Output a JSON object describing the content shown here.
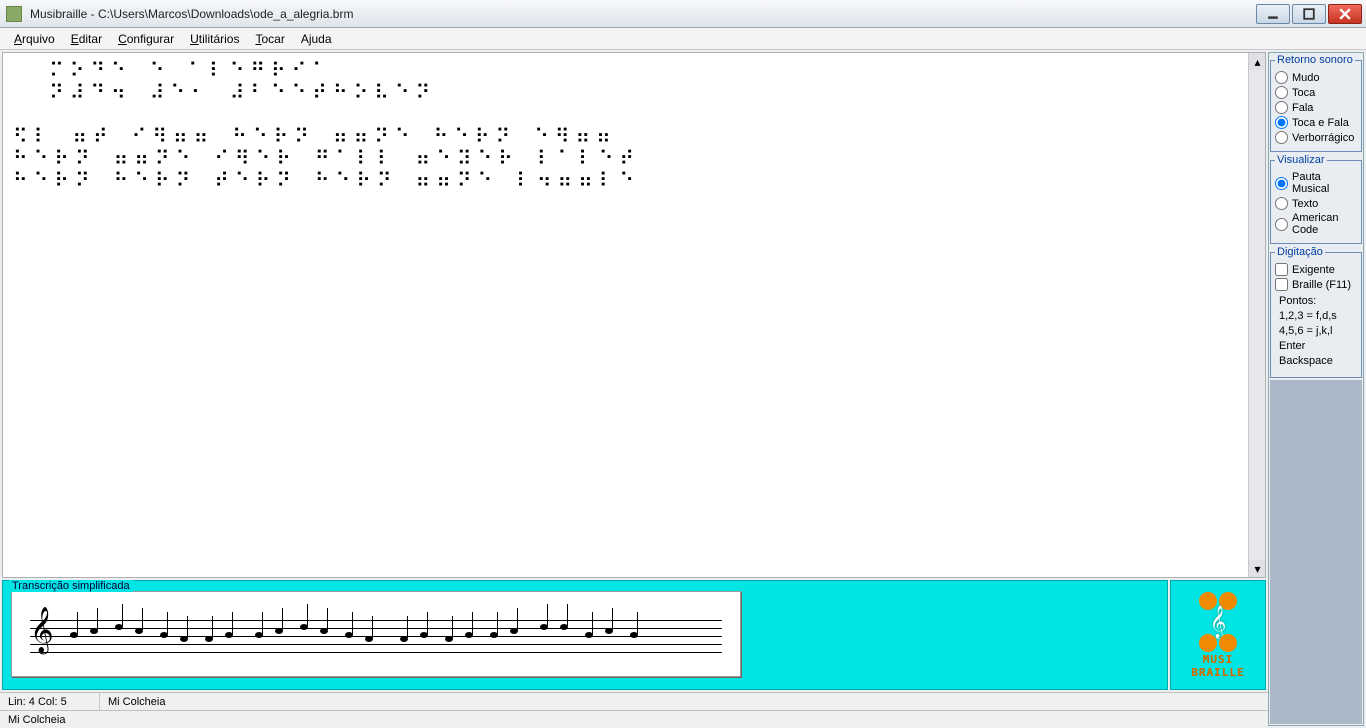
{
  "title": "Musibraille - C:\\Users\\Marcos\\Downloads\\ode_a_alegria.brm",
  "menu": [
    "Arquivo",
    "Editar",
    "Configurar",
    "Utilitários",
    "Tocar",
    "Ajuda"
  ],
  "braille_lines": [
    "  ⠍⠕⠙⠑ ⠑ ⠁⠇⠑⠛⠗⠊⠁",
    "  ⠝⠼⠙⠲ ⠼⠑⠂ ⠼⠃⠑⠑⠞⠓⠕⠧⠑⠝",
    "",
    "⠫⠇ ⠶⠞ ⠊⠻⠶⠶ ⠓⠑⠗⠝ ⠶⠶⠝⠑ ⠓⠑⠗⠝ ⠑⠻⠶⠶",
    "⠓⠑⠗⠝ ⠶⠶⠝⠑ ⠊⠻⠑⠗ ⠛⠁⠇⠇ ⠶⠑⠽⠑⠗ ⠇⠁⠇⠑⠞",
    "⠓⠑⠗⠝ ⠓⠑⠗⠝ ⠞⠑⠗⠝ ⠓⠑⠗⠝ ⠶⠶⠝⠑ ⠇⠲⠶⠶⠇⠑"
  ],
  "right": {
    "groups": {
      "retorno": {
        "legend": "Retorno sonoro",
        "options": [
          "Mudo",
          "Toca",
          "Fala",
          "Toca e Fala",
          "Verborrágico"
        ],
        "selected": "Toca e Fala"
      },
      "visualizar": {
        "legend": "Visualizar",
        "options": [
          "Pauta Musical",
          "Texto",
          "American Code"
        ],
        "selected": "Pauta Musical"
      },
      "digitacao": {
        "legend": "Digitação",
        "checks": [
          "Exigente",
          "Braille (F11)"
        ]
      }
    },
    "pontos": {
      "title": "Pontos:",
      "l1": "1,2,3 = f,d,s",
      "l2": "4,5,6 = j,k,l",
      "l3": "Enter  Backspace"
    }
  },
  "transcription": {
    "legend": "Transcrição simplificada"
  },
  "logo": {
    "line1": "MUSI",
    "line2": "BRAILLE"
  },
  "status": {
    "pos": "Lin: 4 Col: 5",
    "note1": "Mi Colcheia",
    "note2": "Mi Colcheia"
  }
}
